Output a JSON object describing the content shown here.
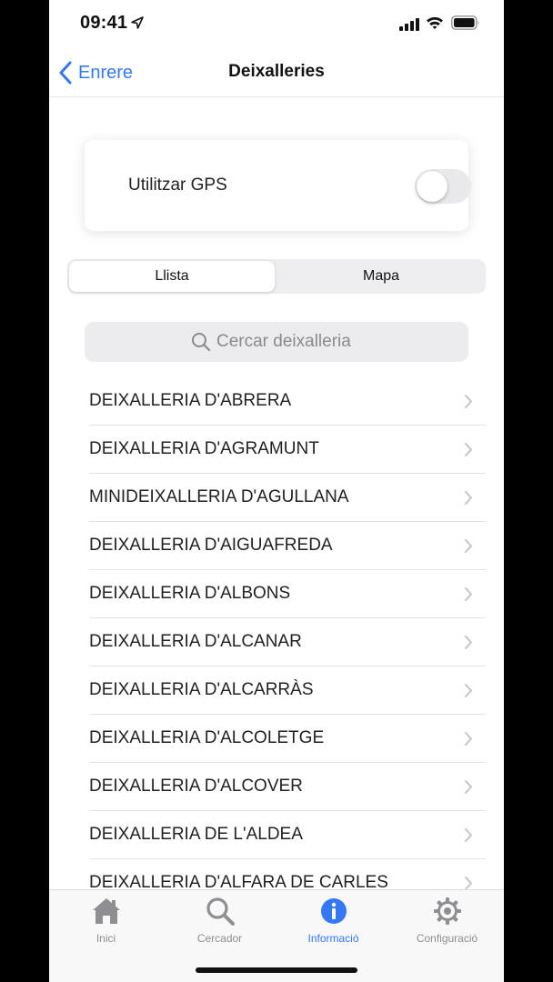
{
  "status_bar": {
    "time": "09:41"
  },
  "nav": {
    "back_label": "Enrere",
    "title": "Deixalleries"
  },
  "gps": {
    "label": "Utilitzar GPS",
    "enabled": false
  },
  "segments": {
    "list": "Llista",
    "map": "Mapa",
    "selected": "Llista"
  },
  "search": {
    "placeholder": "Cercar deixalleria",
    "value": ""
  },
  "list": {
    "items": [
      {
        "label": "DEIXALLERIA D'ABRERA"
      },
      {
        "label": "DEIXALLERIA D'AGRAMUNT"
      },
      {
        "label": "MINIDEIXALLERIA D'AGULLANA"
      },
      {
        "label": "DEIXALLERIA D'AIGUAFREDA"
      },
      {
        "label": "DEIXALLERIA D'ALBONS"
      },
      {
        "label": "DEIXALLERIA D'ALCANAR"
      },
      {
        "label": "DEIXALLERIA D'ALCARRÀS"
      },
      {
        "label": "DEIXALLERIA D'ALCOLETGE"
      },
      {
        "label": "DEIXALLERIA D'ALCOVER"
      },
      {
        "label": "DEIXALLERIA DE L'ALDEA"
      },
      {
        "label": "DEIXALLERIA D'ALFARA DE CARLES"
      }
    ]
  },
  "tab_bar": {
    "tabs": [
      {
        "label": "Inici",
        "icon": "house-icon"
      },
      {
        "label": "Cercador",
        "icon": "magnifier-icon"
      },
      {
        "label": "Informació",
        "icon": "info-icon"
      },
      {
        "label": "Configuració",
        "icon": "gear-icon"
      }
    ],
    "active": "Informació"
  },
  "colors": {
    "accent": "#3478f6",
    "inactive_tab": "#8e8e93"
  }
}
